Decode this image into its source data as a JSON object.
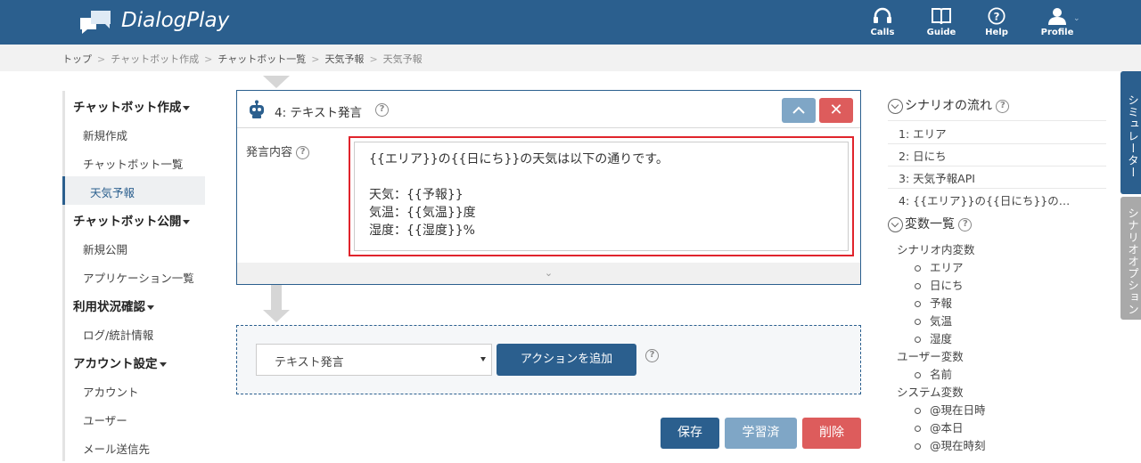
{
  "app": {
    "title": "DialogPlay"
  },
  "nav": [
    {
      "label": "Calls",
      "icon": "headset-icon"
    },
    {
      "label": "Guide",
      "icon": "book-icon"
    },
    {
      "label": "Help",
      "icon": "help-icon"
    },
    {
      "label": "Profile",
      "icon": "user-icon"
    }
  ],
  "breadcrumb": [
    "トップ",
    "チャットボット作成",
    "チャットボット一覧",
    "天気予報",
    "天気予報"
  ],
  "sidebar": {
    "sections": [
      {
        "label": "チャットボット作成",
        "items": [
          "新規作成",
          "チャットボット一覧",
          "天気予報"
        ]
      },
      {
        "label": "チャットボット公開",
        "items": [
          "新規公開",
          "アプリケーション一覧"
        ]
      },
      {
        "label": "利用状況確認",
        "items": [
          "ログ/統計情報"
        ]
      },
      {
        "label": "アカウント設定",
        "items": [
          "アカウント",
          "ユーザー",
          "メール送信先"
        ]
      }
    ],
    "active": "天気予報"
  },
  "action_card": {
    "title": "4: テキスト発言",
    "field_label": "発言内容",
    "text": "{{エリア}}の{{日にち}}の天気は以下の通りです。\n\n天気：{{予報}}\n気温：{{気温}}度\n湿度：{{湿度}}%",
    "help": "?"
  },
  "add_action": {
    "selected": "テキスト発言",
    "button": "アクションを追加"
  },
  "footer_buttons": {
    "save": "保存",
    "learned": "学習済",
    "delete": "削除"
  },
  "scenario_flow": {
    "title": "シナリオの流れ",
    "items": [
      "1: エリア",
      "2: 日にち",
      "3: 天気予報API",
      "4: {{エリア}}の{{日にち}}の…"
    ]
  },
  "variables": {
    "title": "変数一覧",
    "groups": [
      {
        "label": "シナリオ内変数",
        "items": [
          "エリア",
          "日にち",
          "予報",
          "気温",
          "湿度"
        ]
      },
      {
        "label": "ユーザー変数",
        "items": [
          "名前"
        ]
      },
      {
        "label": "システム変数",
        "items": [
          "@現在日時",
          "@本日",
          "@現在時刻"
        ]
      }
    ]
  },
  "side_tabs": [
    "シミュレーター",
    "シナリオオプション"
  ],
  "colors": {
    "primary": "#2b5f8e",
    "danger": "#dd5c5c",
    "muted_blue": "#7fa6c6",
    "highlight": "#e0242c"
  }
}
